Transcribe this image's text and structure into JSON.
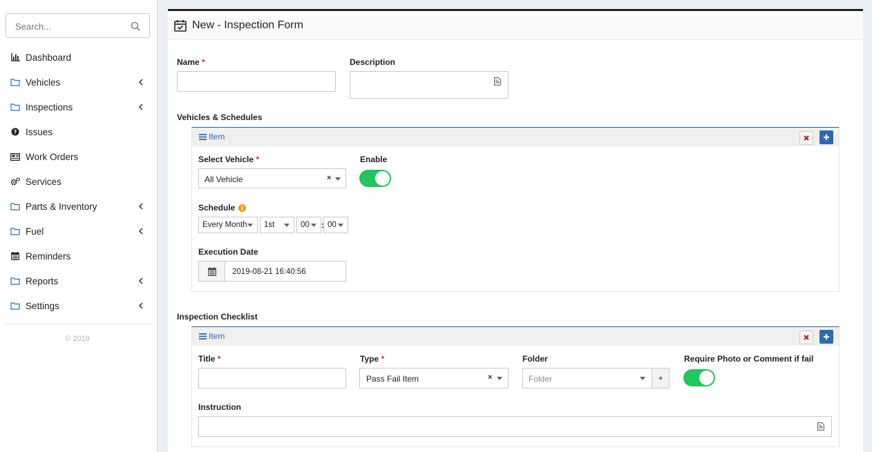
{
  "sidebar": {
    "search_placeholder": "Search...",
    "items": [
      {
        "label": "Dashboard",
        "icon": "bar-chart-icon",
        "has_children": false
      },
      {
        "label": "Vehicles",
        "icon": "folder-icon",
        "has_children": true
      },
      {
        "label": "Inspections",
        "icon": "folder-icon",
        "has_children": true
      },
      {
        "label": "Issues",
        "icon": "question-circle-icon",
        "has_children": false
      },
      {
        "label": "Work Orders",
        "icon": "newspaper-icon",
        "has_children": false
      },
      {
        "label": "Services",
        "icon": "gears-icon",
        "has_children": false
      },
      {
        "label": "Parts & Inventory",
        "icon": "folder-icon",
        "has_children": true
      },
      {
        "label": "Fuel",
        "icon": "folder-icon",
        "has_children": true
      },
      {
        "label": "Reminders",
        "icon": "calendar-icon",
        "has_children": false
      },
      {
        "label": "Reports",
        "icon": "folder-icon",
        "has_children": true
      },
      {
        "label": "Settings",
        "icon": "folder-icon",
        "has_children": true
      }
    ],
    "copyright": "© 2019"
  },
  "form": {
    "title": "New - Inspection Form",
    "name_label": "Name",
    "name_value": "",
    "description_label": "Description",
    "description_value": "",
    "required_mark": "*",
    "vehicles_section": {
      "label": "Vehicles & Schedules",
      "item_label": "Item",
      "select_vehicle_label": "Select Vehicle",
      "select_vehicle_value": "All Vehicle",
      "clear_glyph": "×",
      "enable_label": "Enable",
      "enable_on": true,
      "schedule_label": "Schedule",
      "schedule": {
        "frequency": "Every Month",
        "day": "1st",
        "hour": "00",
        "separator": ":",
        "minute": "00"
      },
      "execution_date_label": "Execution Date",
      "execution_date_value": "2019-08-21 16:40:56"
    },
    "checklist_section": {
      "label": "Inspection Checklist",
      "item_label": "Item",
      "title_label": "Title",
      "title_value": "",
      "type_label": "Type",
      "type_value": "Pass Fail Item",
      "clear_glyph": "×",
      "folder_label": "Folder",
      "folder_placeholder": "Folder",
      "folder_add_glyph": "+",
      "require_label": "Require Photo or Comment if fail",
      "require_on": true,
      "instruction_label": "Instruction",
      "instruction_value": ""
    }
  },
  "colors": {
    "accent_blue": "#2c6bb2",
    "toggle_green": "#22c55e",
    "required_red": "#c0392b",
    "info_orange": "#f39c12"
  }
}
